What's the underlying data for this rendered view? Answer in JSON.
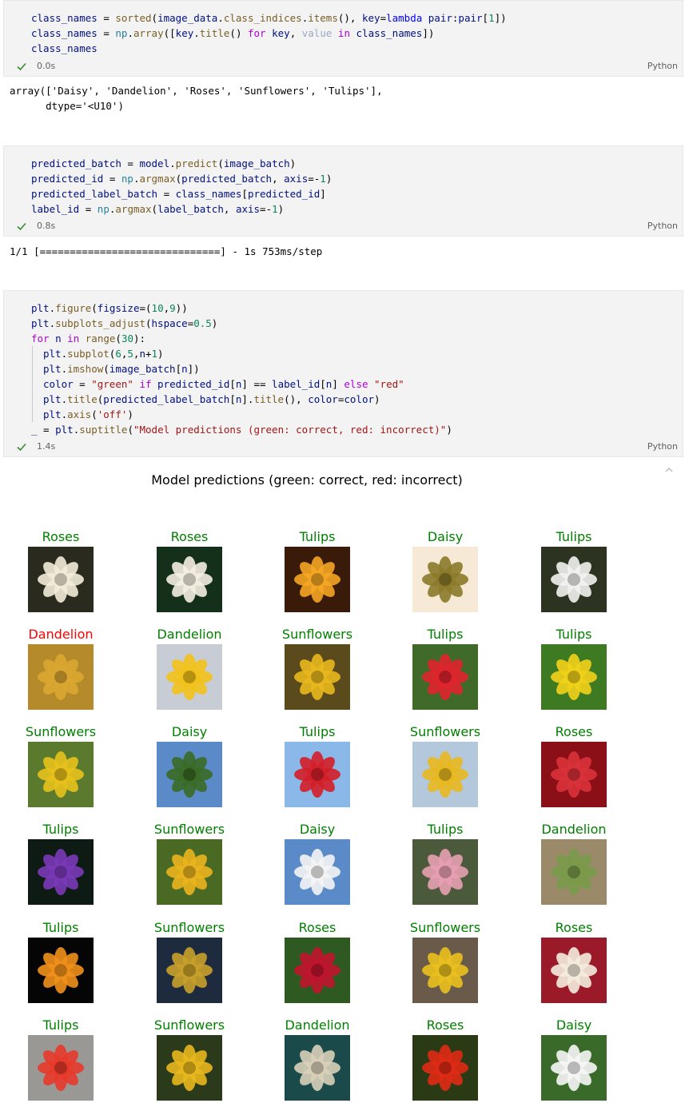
{
  "cell1": {
    "lines": [
      "class_names = sorted(image_data.class_indices.items(), key=lambda pair:pair[1])",
      "class_names = np.array([key.title() for key, value in class_names])",
      "class_names"
    ],
    "time": "0.0s",
    "language": "Python",
    "output": [
      "array(['Daisy', 'Dandelion', 'Roses', 'Sunflowers', 'Tulips'],",
      "      dtype='<U10')"
    ]
  },
  "cell2": {
    "lines": [
      "predicted_batch = model.predict(image_batch)",
      "predicted_id = np.argmax(predicted_batch, axis=-1)",
      "predicted_label_batch = class_names[predicted_id]",
      "label_id = np.argmax(label_batch, axis=-1)"
    ],
    "time": "0.8s",
    "language": "Python",
    "output": [
      "1/1 [==============================] - 1s 753ms/step"
    ]
  },
  "cell3": {
    "lines": [
      "plt.figure(figsize=(10,9))",
      "plt.subplots_adjust(hspace=0.5)",
      "for n in range(30):",
      "  plt.subplot(6,5,n+1)",
      "  plt.imshow(image_batch[n])",
      "  color = \"green\" if predicted_id[n] == label_id[n] else \"red\"",
      "  plt.title(predicted_label_batch[n].title(), color=color)",
      "  plt.axis('off')",
      "_ = plt.suptitle(\"Model predictions (green: correct, red: incorrect)\")"
    ],
    "time": "1.4s",
    "language": "Python"
  },
  "figure": {
    "suptitle": "Model predictions (green: correct, red: incorrect)",
    "colors": {
      "correct": "#008000",
      "incorrect": "#ff0000"
    },
    "predictions": [
      {
        "label": "Roses",
        "correct": true,
        "bg": "#2a2a1f",
        "accent": "#f2ecd8"
      },
      {
        "label": "Roses",
        "correct": true,
        "bg": "#14301a",
        "accent": "#f4eee2"
      },
      {
        "label": "Tulips",
        "correct": true,
        "bg": "#3a1a08",
        "accent": "#f5a623"
      },
      {
        "label": "Daisy",
        "correct": true,
        "bg": "#f6ead6",
        "accent": "#8a7a2a"
      },
      {
        "label": "Tulips",
        "correct": true,
        "bg": "#2c3320",
        "accent": "#f2f2f0"
      },
      {
        "label": "Dandelion",
        "correct": false,
        "bg": "#b58a2a",
        "accent": "#d9a630"
      },
      {
        "label": "Dandelion",
        "correct": true,
        "bg": "#c8ccd4",
        "accent": "#f2c21a"
      },
      {
        "label": "Sunflowers",
        "correct": true,
        "bg": "#5a4a1c",
        "accent": "#e8b81e"
      },
      {
        "label": "Tulips",
        "correct": true,
        "bg": "#3f6a2a",
        "accent": "#e0242e"
      },
      {
        "label": "Tulips",
        "correct": true,
        "bg": "#3e7a22",
        "accent": "#f2d21a"
      },
      {
        "label": "Sunflowers",
        "correct": true,
        "bg": "#5c7a2e",
        "accent": "#e8c21c"
      },
      {
        "label": "Daisy",
        "correct": true,
        "bg": "#5a8ac8",
        "accent": "#3a6a26"
      },
      {
        "label": "Tulips",
        "correct": true,
        "bg": "#8ab8e8",
        "accent": "#d41e28"
      },
      {
        "label": "Sunflowers",
        "correct": true,
        "bg": "#b4c8dc",
        "accent": "#e8b81e"
      },
      {
        "label": "Roses",
        "correct": true,
        "bg": "#8a0f16",
        "accent": "#d8323a"
      },
      {
        "label": "Tulips",
        "correct": true,
        "bg": "#0e1a14",
        "accent": "#7a3ab8"
      },
      {
        "label": "Sunflowers",
        "correct": true,
        "bg": "#4a6a24",
        "accent": "#eab41e"
      },
      {
        "label": "Daisy",
        "correct": true,
        "bg": "#5a8ac8",
        "accent": "#f4f4f4"
      },
      {
        "label": "Tulips",
        "correct": true,
        "bg": "#4a5a3a",
        "accent": "#e8a0b4"
      },
      {
        "label": "Dandelion",
        "correct": true,
        "bg": "#9a8a6a",
        "accent": "#7a9a4a"
      },
      {
        "label": "Tulips",
        "correct": true,
        "bg": "#050505",
        "accent": "#f0901a"
      },
      {
        "label": "Sunflowers",
        "correct": true,
        "bg": "#1e2a3e",
        "accent": "#c8a02a"
      },
      {
        "label": "Roses",
        "correct": true,
        "bg": "#2e5a22",
        "accent": "#c0142e"
      },
      {
        "label": "Sunflowers",
        "correct": true,
        "bg": "#6a5a4a",
        "accent": "#eac01e"
      },
      {
        "label": "Roses",
        "correct": true,
        "bg": "#9a1a2a",
        "accent": "#f4ecde"
      },
      {
        "label": "Tulips",
        "correct": true,
        "bg": "#9a9894",
        "accent": "#e83a2a"
      },
      {
        "label": "Sunflowers",
        "correct": true,
        "bg": "#2a3a1a",
        "accent": "#e8b81e"
      },
      {
        "label": "Dandelion",
        "correct": true,
        "bg": "#1a4a4a",
        "accent": "#d8d0b8"
      },
      {
        "label": "Roses",
        "correct": true,
        "bg": "#2a3a14",
        "accent": "#e02a14"
      },
      {
        "label": "Daisy",
        "correct": true,
        "bg": "#3a6a2a",
        "accent": "#f6f6f6"
      }
    ]
  }
}
